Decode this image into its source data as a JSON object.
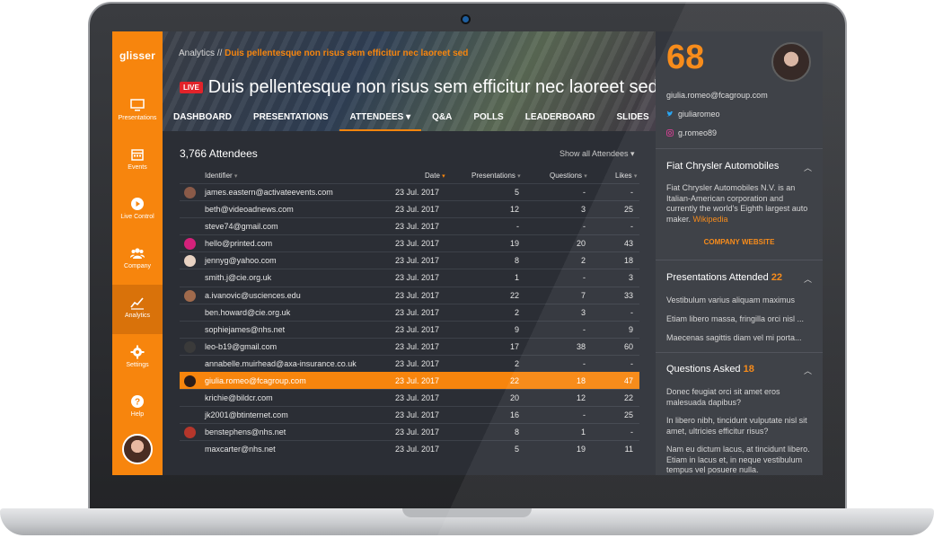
{
  "sidebar": {
    "logo": "glisser",
    "items": [
      {
        "label": "Presentations",
        "icon": "monitor-icon"
      },
      {
        "label": "Events",
        "icon": "calendar-icon"
      },
      {
        "label": "Live Control",
        "icon": "play-icon"
      },
      {
        "label": "Company",
        "icon": "users-icon"
      },
      {
        "label": "Analytics",
        "icon": "chart-icon",
        "active": true
      },
      {
        "label": "Settings",
        "icon": "gear-icon"
      },
      {
        "label": "Help",
        "icon": "help-icon"
      }
    ]
  },
  "header": {
    "breadcrumb_root": "Analytics //",
    "breadcrumb_current": "Duis pellentesque non risus sem efficitur nec laoreet sed",
    "live_badge": "LIVE",
    "title": "Duis pellentesque non risus sem efficitur nec laoreet sed",
    "tabs": [
      {
        "label": "DASHBOARD"
      },
      {
        "label": "PRESENTATIONS"
      },
      {
        "label": "ATTENDEES ▾",
        "active": true
      },
      {
        "label": "Q&A"
      },
      {
        "label": "POLLS"
      },
      {
        "label": "LEADERBOARD"
      },
      {
        "label": "SLIDES"
      }
    ]
  },
  "attendees": {
    "count_label": "3,766 Attendees",
    "filter_label": "Show all Attendees ▾",
    "columns": {
      "identifier": "Identifier",
      "date": "Date",
      "presentations": "Presentations",
      "questions": "Questions",
      "likes": "Likes"
    },
    "rows": [
      {
        "email": "james.eastern@activateevents.com",
        "date": "23 Jul. 2017",
        "presentations": "5",
        "questions": "-",
        "likes": "-",
        "avatar": "#8a5a48"
      },
      {
        "email": "beth@videoadnews.com",
        "date": "23 Jul. 2017",
        "presentations": "12",
        "questions": "3",
        "likes": "25"
      },
      {
        "email": "steve74@gmail.com",
        "date": "23 Jul. 2017",
        "presentations": "-",
        "questions": "-",
        "likes": "-"
      },
      {
        "email": "hello@printed.com",
        "date": "23 Jul. 2017",
        "presentations": "19",
        "questions": "20",
        "likes": "43",
        "avatar": "#d4217a"
      },
      {
        "email": "jennyg@yahoo.com",
        "date": "23 Jul. 2017",
        "presentations": "8",
        "questions": "2",
        "likes": "18",
        "avatar": "#e8d2c2"
      },
      {
        "email": "smith.j@cie.org.uk",
        "date": "23 Jul. 2017",
        "presentations": "1",
        "questions": "-",
        "likes": "3"
      },
      {
        "email": "a.ivanovic@usciences.edu",
        "date": "23 Jul. 2017",
        "presentations": "22",
        "questions": "7",
        "likes": "33",
        "avatar": "#a06a4c"
      },
      {
        "email": "ben.howard@cie.org.uk",
        "date": "23 Jul. 2017",
        "presentations": "2",
        "questions": "3",
        "likes": "-"
      },
      {
        "email": "sophiejames@nhs.net",
        "date": "23 Jul. 2017",
        "presentations": "9",
        "questions": "-",
        "likes": "9"
      },
      {
        "email": "leo-b19@gmail.com",
        "date": "23 Jul. 2017",
        "presentations": "17",
        "questions": "38",
        "likes": "60",
        "avatar": "#3a3a3a"
      },
      {
        "email": "annabelle.muirhead@axa-insurance.co.uk",
        "date": "23 Jul. 2017",
        "presentations": "2",
        "questions": "-",
        "likes": "-"
      },
      {
        "email": "giulia.romeo@fcagroup.com",
        "date": "23 Jul. 2017",
        "presentations": "22",
        "questions": "18",
        "likes": "47",
        "avatar": "#2b1d1a",
        "highlight": true
      },
      {
        "email": "krichie@bildcr.com",
        "date": "23 Jul. 2017",
        "presentations": "20",
        "questions": "12",
        "likes": "22"
      },
      {
        "email": "jk2001@btinternet.com",
        "date": "23 Jul. 2017",
        "presentations": "16",
        "questions": "-",
        "likes": "25"
      },
      {
        "email": "benstephens@nhs.net",
        "date": "23 Jul. 2017",
        "presentations": "8",
        "questions": "1",
        "likes": "-",
        "avatar": "#b5362b"
      },
      {
        "email": "maxcarter@nhs.net",
        "date": "23 Jul. 2017",
        "presentations": "5",
        "questions": "19",
        "likes": "11"
      }
    ]
  },
  "profile": {
    "score": "68",
    "email": "giulia.romeo@fcagroup.com",
    "twitter": "giuliaromeo",
    "instagram": "g.romeo89",
    "company": {
      "name": "Fiat Chrysler Automobiles",
      "description": "Fiat Chrysler Automobiles N.V. is an Italian-American corporation and currently the world's Eighth largest auto maker.",
      "link_text": "Wikipedia",
      "website_label": "COMPANY WEBSITE"
    },
    "presentations": {
      "title": "Presentations Attended",
      "count": "22",
      "items": [
        "Vestibulum varius aliquam maximus",
        "Etiam libero massa, fringilla orci nisl ...",
        "Maecenas sagittis diam vel mi porta..."
      ]
    },
    "questions": {
      "title": "Questions Asked",
      "count": "18",
      "items": [
        "Donec feugiat orci sit amet eros malesuada dapibus?",
        "In libero nibh, tincidunt vulputate nisl sit amet, ultricies efficitur risus?",
        "Nam eu dictum lacus, at tincidunt libero. Etiam in lacus et, in neque vestibulum tempus vel posuere nulla."
      ]
    }
  }
}
